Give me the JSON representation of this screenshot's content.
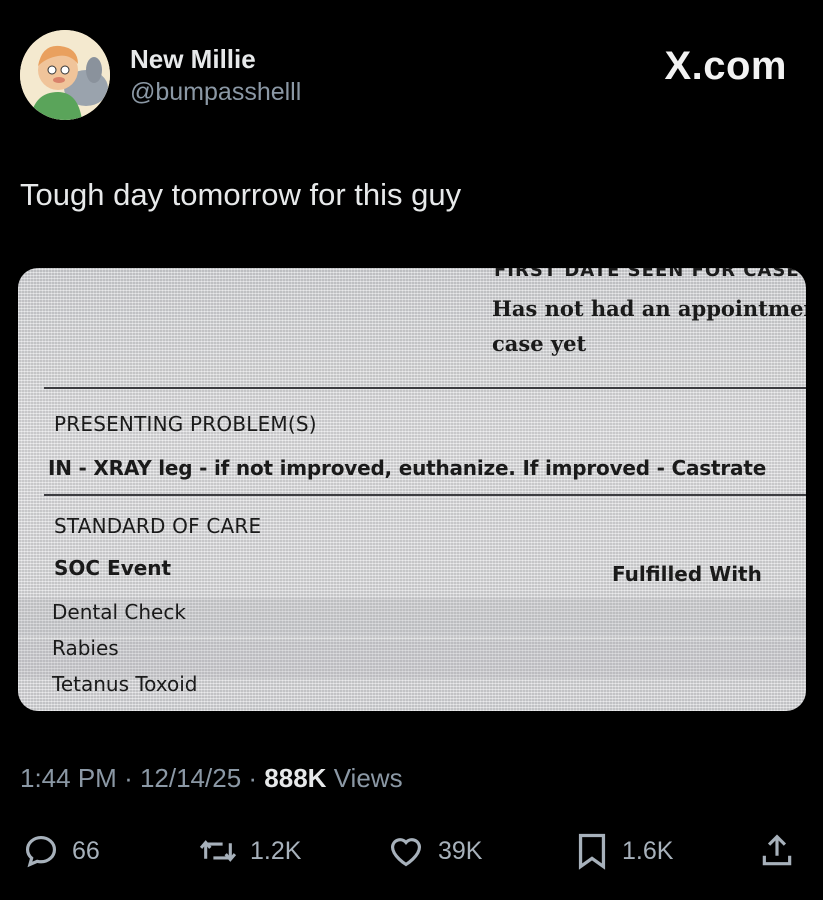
{
  "author": {
    "display_name": "New Millie",
    "handle": "@bumpasshelll"
  },
  "brand": "X.com",
  "tweet": {
    "text": "Tough day tomorrow for this guy"
  },
  "media": {
    "cut_heading": "FIRST DATE SEEN FOR CASE",
    "appointment_line1": "Has not had an appointmen",
    "appointment_line2": "case yet",
    "presenting_label": "PRESENTING PROBLEM(S)",
    "presenting_text": "IN - XRAY leg - if not improved, euthanize. If improved - Castrate",
    "standard_label": "STANDARD OF CARE",
    "soc_event_header": "SOC Event",
    "fulfilled_header": "Fulfilled With",
    "soc_items": [
      "Dental Check",
      "Rabies",
      "Tetanus Toxoid"
    ]
  },
  "meta": {
    "time": "1:44 PM",
    "date": "12/14/25",
    "views_count": "888K",
    "views_label": "Views"
  },
  "actions": {
    "replies": "66",
    "reposts": "1.2K",
    "likes": "39K",
    "bookmarks": "1.6K"
  },
  "colors": {
    "background": "#000000",
    "primary_text": "#e7e9ea",
    "secondary_text": "#8b98a5"
  }
}
